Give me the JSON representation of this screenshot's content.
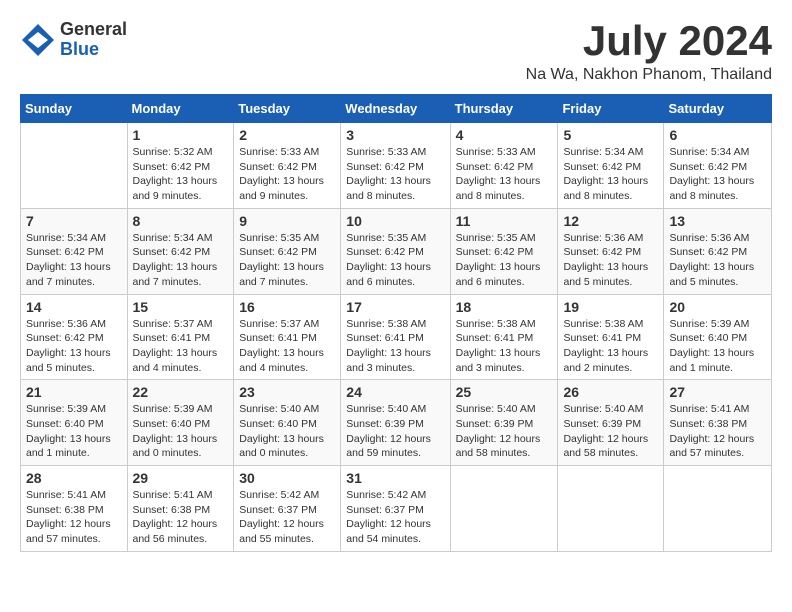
{
  "header": {
    "logo_general": "General",
    "logo_blue": "Blue",
    "month_title": "July 2024",
    "location": "Na Wa, Nakhon Phanom, Thailand"
  },
  "columns": [
    "Sunday",
    "Monday",
    "Tuesday",
    "Wednesday",
    "Thursday",
    "Friday",
    "Saturday"
  ],
  "weeks": [
    [
      {
        "day": "",
        "info": ""
      },
      {
        "day": "1",
        "info": "Sunrise: 5:32 AM\nSunset: 6:42 PM\nDaylight: 13 hours and 9 minutes."
      },
      {
        "day": "2",
        "info": "Sunrise: 5:33 AM\nSunset: 6:42 PM\nDaylight: 13 hours and 9 minutes."
      },
      {
        "day": "3",
        "info": "Sunrise: 5:33 AM\nSunset: 6:42 PM\nDaylight: 13 hours and 8 minutes."
      },
      {
        "day": "4",
        "info": "Sunrise: 5:33 AM\nSunset: 6:42 PM\nDaylight: 13 hours and 8 minutes."
      },
      {
        "day": "5",
        "info": "Sunrise: 5:34 AM\nSunset: 6:42 PM\nDaylight: 13 hours and 8 minutes."
      },
      {
        "day": "6",
        "info": "Sunrise: 5:34 AM\nSunset: 6:42 PM\nDaylight: 13 hours and 8 minutes."
      }
    ],
    [
      {
        "day": "7",
        "info": "Sunrise: 5:34 AM\nSunset: 6:42 PM\nDaylight: 13 hours and 7 minutes."
      },
      {
        "day": "8",
        "info": "Sunrise: 5:34 AM\nSunset: 6:42 PM\nDaylight: 13 hours and 7 minutes."
      },
      {
        "day": "9",
        "info": "Sunrise: 5:35 AM\nSunset: 6:42 PM\nDaylight: 13 hours and 7 minutes."
      },
      {
        "day": "10",
        "info": "Sunrise: 5:35 AM\nSunset: 6:42 PM\nDaylight: 13 hours and 6 minutes."
      },
      {
        "day": "11",
        "info": "Sunrise: 5:35 AM\nSunset: 6:42 PM\nDaylight: 13 hours and 6 minutes."
      },
      {
        "day": "12",
        "info": "Sunrise: 5:36 AM\nSunset: 6:42 PM\nDaylight: 13 hours and 5 minutes."
      },
      {
        "day": "13",
        "info": "Sunrise: 5:36 AM\nSunset: 6:42 PM\nDaylight: 13 hours and 5 minutes."
      }
    ],
    [
      {
        "day": "14",
        "info": "Sunrise: 5:36 AM\nSunset: 6:42 PM\nDaylight: 13 hours and 5 minutes."
      },
      {
        "day": "15",
        "info": "Sunrise: 5:37 AM\nSunset: 6:41 PM\nDaylight: 13 hours and 4 minutes."
      },
      {
        "day": "16",
        "info": "Sunrise: 5:37 AM\nSunset: 6:41 PM\nDaylight: 13 hours and 4 minutes."
      },
      {
        "day": "17",
        "info": "Sunrise: 5:38 AM\nSunset: 6:41 PM\nDaylight: 13 hours and 3 minutes."
      },
      {
        "day": "18",
        "info": "Sunrise: 5:38 AM\nSunset: 6:41 PM\nDaylight: 13 hours and 3 minutes."
      },
      {
        "day": "19",
        "info": "Sunrise: 5:38 AM\nSunset: 6:41 PM\nDaylight: 13 hours and 2 minutes."
      },
      {
        "day": "20",
        "info": "Sunrise: 5:39 AM\nSunset: 6:40 PM\nDaylight: 13 hours and 1 minute."
      }
    ],
    [
      {
        "day": "21",
        "info": "Sunrise: 5:39 AM\nSunset: 6:40 PM\nDaylight: 13 hours and 1 minute."
      },
      {
        "day": "22",
        "info": "Sunrise: 5:39 AM\nSunset: 6:40 PM\nDaylight: 13 hours and 0 minutes."
      },
      {
        "day": "23",
        "info": "Sunrise: 5:40 AM\nSunset: 6:40 PM\nDaylight: 13 hours and 0 minutes."
      },
      {
        "day": "24",
        "info": "Sunrise: 5:40 AM\nSunset: 6:39 PM\nDaylight: 12 hours and 59 minutes."
      },
      {
        "day": "25",
        "info": "Sunrise: 5:40 AM\nSunset: 6:39 PM\nDaylight: 12 hours and 58 minutes."
      },
      {
        "day": "26",
        "info": "Sunrise: 5:40 AM\nSunset: 6:39 PM\nDaylight: 12 hours and 58 minutes."
      },
      {
        "day": "27",
        "info": "Sunrise: 5:41 AM\nSunset: 6:38 PM\nDaylight: 12 hours and 57 minutes."
      }
    ],
    [
      {
        "day": "28",
        "info": "Sunrise: 5:41 AM\nSunset: 6:38 PM\nDaylight: 12 hours and 57 minutes."
      },
      {
        "day": "29",
        "info": "Sunrise: 5:41 AM\nSunset: 6:38 PM\nDaylight: 12 hours and 56 minutes."
      },
      {
        "day": "30",
        "info": "Sunrise: 5:42 AM\nSunset: 6:37 PM\nDaylight: 12 hours and 55 minutes."
      },
      {
        "day": "31",
        "info": "Sunrise: 5:42 AM\nSunset: 6:37 PM\nDaylight: 12 hours and 54 minutes."
      },
      {
        "day": "",
        "info": ""
      },
      {
        "day": "",
        "info": ""
      },
      {
        "day": "",
        "info": ""
      }
    ]
  ]
}
